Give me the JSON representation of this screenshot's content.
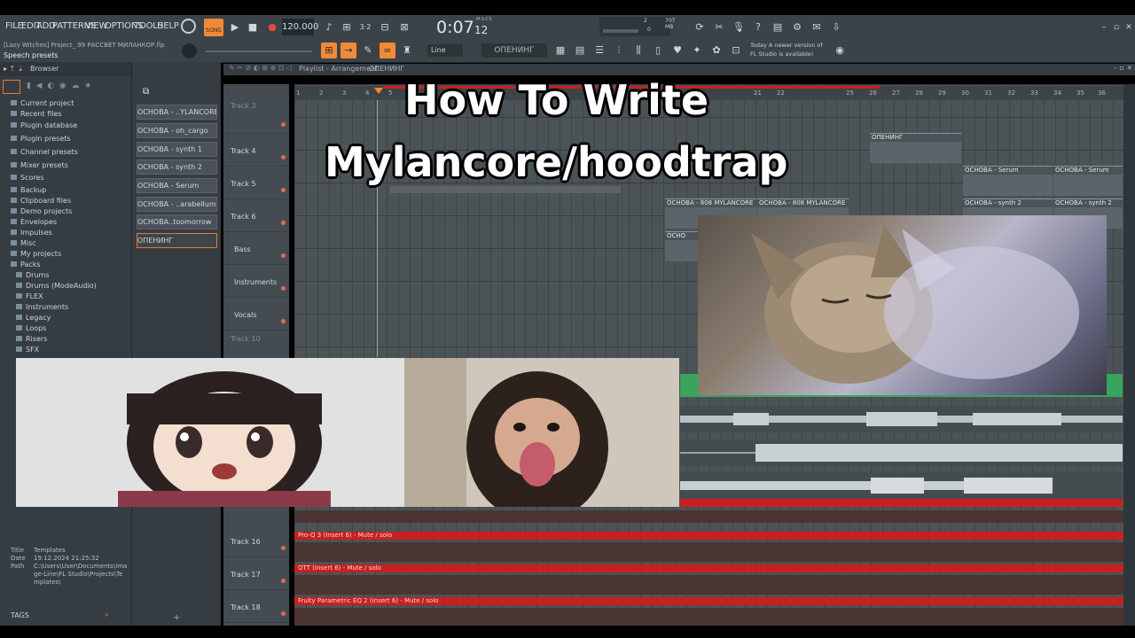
{
  "menu": [
    "FILE",
    "EDIT",
    "ADD",
    "PATTERNS",
    "VIEW",
    "OPTIONS",
    "TOOLS",
    "HELP"
  ],
  "transport": {
    "song_label": "SONG",
    "tempo": "120.000",
    "time": "0:07",
    "time_small": "12",
    "time_units": "M:S:CS",
    "memory": "707 MB",
    "cpu_value": "2",
    "poly_value": "0"
  },
  "project": {
    "file": "[Lazy Witches] Project_.99 РАССВЕТ МИЛАНКОР.flp",
    "hint": "Speech presets"
  },
  "toolbar": {
    "snap": "Line",
    "pattern": "ОПЕНИНГ"
  },
  "news": {
    "line1": "Today  A newer version of",
    "line2": "FL Studio is available!"
  },
  "browser": {
    "title": "Browser",
    "items": [
      "Current project",
      "Recent files",
      "Plugin database",
      "Plugin presets",
      "Channel presets",
      "Mixer presets",
      "Scores",
      "Backup",
      "Clipboard files",
      "Demo projects",
      "Envelopes",
      "Impulses",
      "Misc",
      "My projects",
      "Packs"
    ],
    "pack_items": [
      "Drums",
      "Drums (ModeAudio)",
      "FLEX",
      "Instruments",
      "Legacy",
      "Loops",
      "Risers",
      "SFX"
    ],
    "info_labels": [
      "Title",
      "Date",
      "Path"
    ],
    "info_values": [
      "Templates",
      "19.12.2024 21:25:32",
      "C:\\Users\\User\\Documents\\Image-Line\\FL Studio\\Projects\\Templates\\"
    ],
    "tags": "TAGS"
  },
  "patterns": [
    "ОСНОВА - ..YLANCORE",
    "ОСНОВА - oh_cargo",
    "ОСНОВА - synth 1",
    "ОСНОВА - synth 2",
    "ОСНОВА - Serum",
    "ОСНОВА - ..arabellum",
    "ОСНОВА..toomorrow",
    "ОПЕНИНГ"
  ],
  "playlist": {
    "title": "Playlist - Arrangement",
    "pattern": "ОПЕНИНГ",
    "ruler": [
      "1",
      "2",
      "3",
      "4",
      "5",
      "21",
      "22",
      "25",
      "26",
      "27",
      "28",
      "29",
      "30",
      "31",
      "32",
      "33",
      "34",
      "35",
      "36"
    ],
    "tracks": [
      "Track 3",
      "Track 4",
      "Track 5",
      "Track 6",
      "Bass",
      "Instruments",
      "Vocals",
      "Track 10"
    ],
    "bottom_tracks": [
      "Track 16",
      "Track 17",
      "Track 18"
    ],
    "clips": {
      "opening": "ОПЕНИНГ",
      "serum": "ОСНОВА - Serum",
      "mylancore": "ОСНОВА - 808 MYLANCORE",
      "synth2": "ОСНОВА - synth 2",
      "osnova": "ОСНО"
    },
    "automation": [
      "Pro-Q 3 (Insert 6) - Mute / solo",
      "OTT (Insert 6) - Mute / solo",
      "Fruity Parametric EQ 2 (Insert 6) - Mute / solo"
    ]
  },
  "overlay": {
    "line1": "How To Write",
    "line2": "Mylancore/hoodtrap"
  }
}
